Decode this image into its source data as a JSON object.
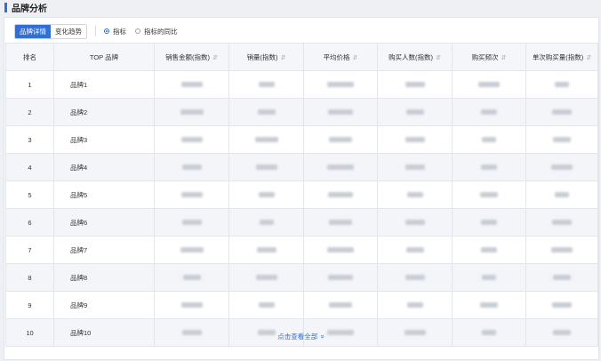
{
  "page": {
    "title": "品牌分析",
    "accent_color": "#2f6fd6"
  },
  "toolbar": {
    "tabs": [
      {
        "label": "品牌详情",
        "active": true
      },
      {
        "label": "变化趋势",
        "active": false
      }
    ],
    "radios": [
      {
        "label": "指标",
        "checked": true
      },
      {
        "label": "指标的同比",
        "checked": false
      }
    ]
  },
  "table": {
    "headers": [
      "排名",
      "TOP 品牌",
      "销售金额(指数)",
      "销量(指数)",
      "平均价格",
      "购买人数(指数)",
      "购买频次",
      "单次购买量(指数)"
    ],
    "sort_icon": "⇵",
    "rows": [
      {
        "rank": "1",
        "brand": "品牌1"
      },
      {
        "rank": "2",
        "brand": "品牌2"
      },
      {
        "rank": "3",
        "brand": "品牌3"
      },
      {
        "rank": "4",
        "brand": "品牌4"
      },
      {
        "rank": "5",
        "brand": "品牌5"
      },
      {
        "rank": "6",
        "brand": "品牌6"
      },
      {
        "rank": "7",
        "brand": "品牌7"
      },
      {
        "rank": "8",
        "brand": "品牌8"
      },
      {
        "rank": "9",
        "brand": "品牌9"
      },
      {
        "rank": "10",
        "brand": "品牌10"
      }
    ]
  },
  "footer": {
    "show_all_label": "点击查看全部",
    "chevron": "»"
  }
}
